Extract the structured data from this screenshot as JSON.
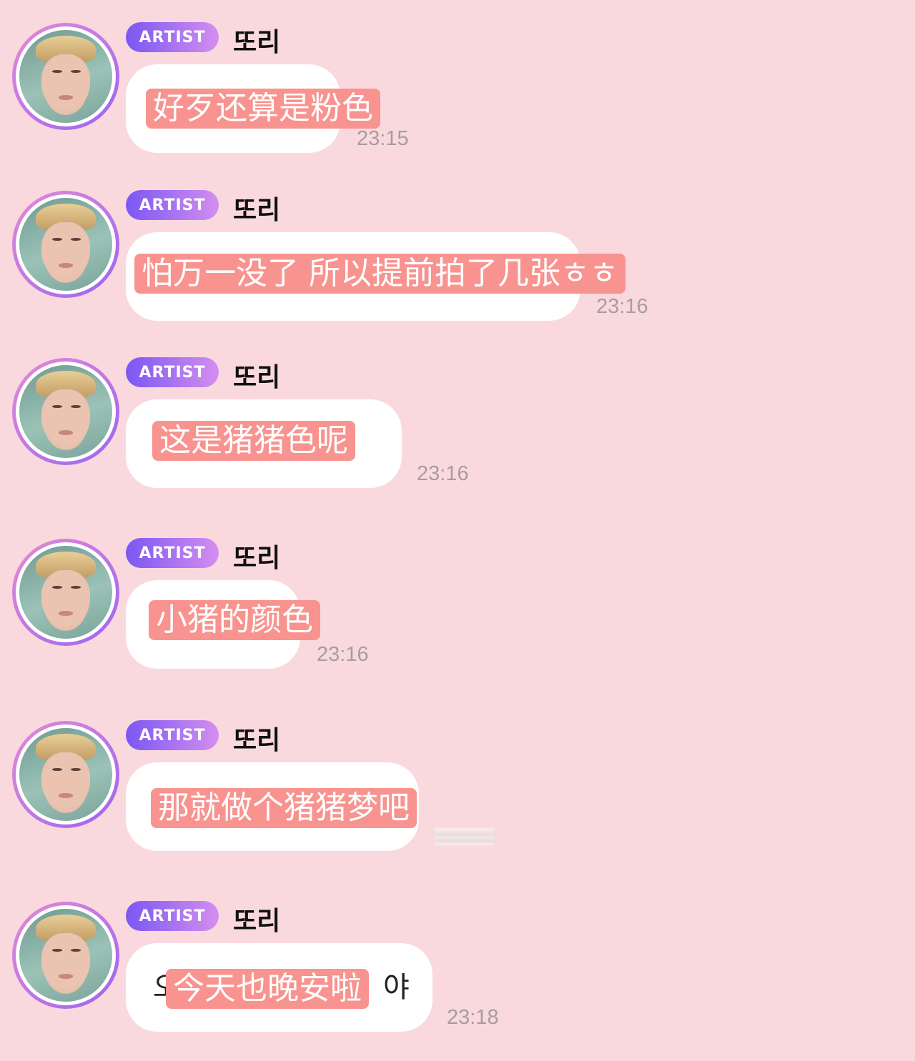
{
  "badge_label": "ARTIST",
  "sender_name": "또리",
  "colors": {
    "background": "#f9d9de",
    "badge_gradient": [
      "#7b57f3",
      "#d48ef0"
    ],
    "highlight": "#f8938f",
    "timestamp": "#a89ca0"
  },
  "messages": [
    {
      "text": "好歹还算是粉色",
      "time": "23:15"
    },
    {
      "text": "怕万一没了 所以提前拍了几张ㅎㅎ",
      "time": "23:16"
    },
    {
      "text": "这是猪猪色呢",
      "time": "23:16"
    },
    {
      "text": "小猪的颜色",
      "time": "23:16"
    },
    {
      "text": "那就做个猪猪梦吧",
      "time": ""
    },
    {
      "text": "今天也晚安啦",
      "text_left_fragment": "오",
      "text_right_fragment": "야",
      "time": "23:18"
    }
  ]
}
